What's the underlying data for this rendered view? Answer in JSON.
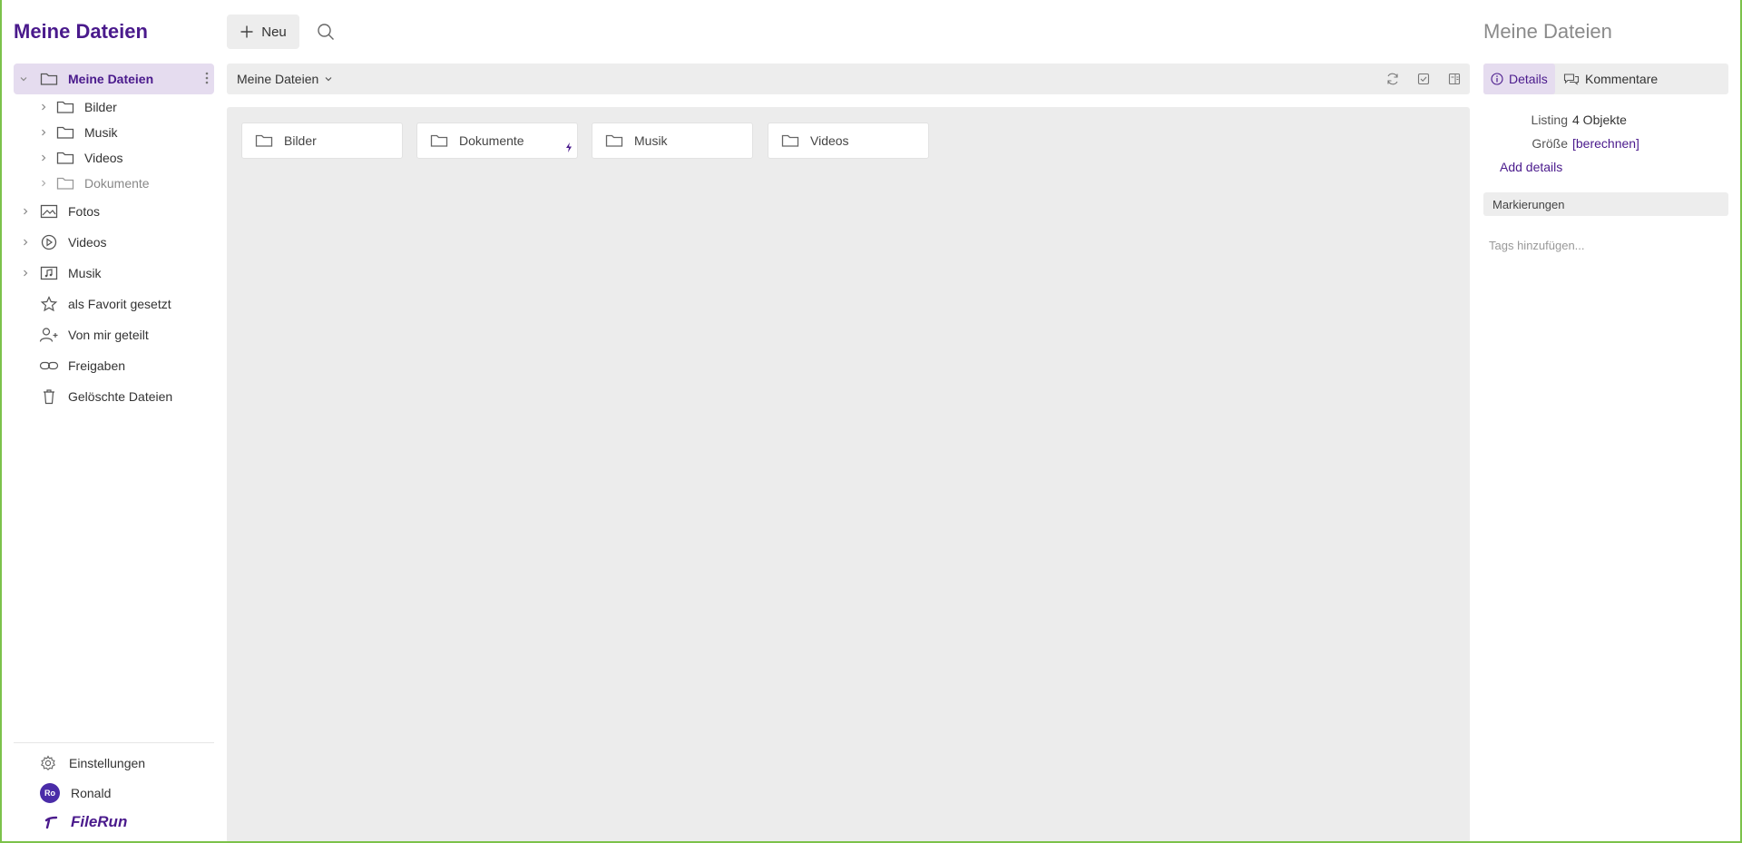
{
  "app": {
    "title": "Meine Dateien"
  },
  "sidebar": {
    "root": {
      "label": "Meine Dateien",
      "icon": "folder-icon"
    },
    "subfolders": [
      {
        "label": "Bilder"
      },
      {
        "label": "Musik"
      },
      {
        "label": "Videos"
      },
      {
        "label": "Dokumente"
      }
    ],
    "sections": [
      {
        "label": "Fotos",
        "icon": "photos-icon"
      },
      {
        "label": "Videos",
        "icon": "play-icon"
      },
      {
        "label": "Musik",
        "icon": "music-icon"
      }
    ],
    "items": [
      {
        "label": "als Favorit gesetzt",
        "icon": "star-icon"
      },
      {
        "label": "Von mir geteilt",
        "icon": "user-plus-icon"
      },
      {
        "label": "Freigaben",
        "icon": "link-icon"
      },
      {
        "label": "Gelöschte Dateien",
        "icon": "trash-icon"
      }
    ],
    "settings": {
      "label": "Einstellungen"
    },
    "user": {
      "name": "Ronald",
      "initials": "Ro"
    },
    "brand": {
      "name": "FileRun"
    }
  },
  "toolbar": {
    "new_label": "Neu"
  },
  "breadcrumb": {
    "label": "Meine Dateien"
  },
  "folders": [
    {
      "label": "Bilder"
    },
    {
      "label": "Dokumente"
    },
    {
      "label": "Musik"
    },
    {
      "label": "Videos"
    }
  ],
  "details": {
    "title": "Meine Dateien",
    "tabs": [
      {
        "label": "Details"
      },
      {
        "label": "Kommentare"
      }
    ],
    "listing_key": "Listing",
    "listing_value": "4 Objekte",
    "size_key": "Größe",
    "size_value": "[berechnen]",
    "add_details": "Add details",
    "tags_header": "Markierungen",
    "tags_placeholder": "Tags hinzufügen..."
  },
  "colors": {
    "accent": "#4a1a8c",
    "active_bg": "#e5dcef",
    "panel_bg": "#ececec",
    "frame": "#7cc24a"
  }
}
